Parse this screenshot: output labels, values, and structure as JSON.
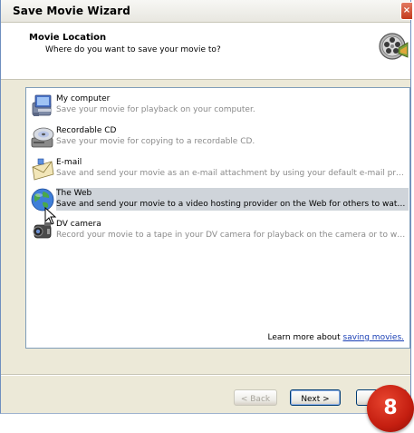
{
  "window": {
    "title": "Save Movie Wizard",
    "close_glyph": "×"
  },
  "header": {
    "title": "Movie Location",
    "subtitle": "Where do you want to save your movie to?",
    "icon": "film-reel-icon"
  },
  "items": [
    {
      "title": "My computer",
      "description": "Save your movie for playback on your computer.",
      "icon": "computer-icon",
      "selected": false
    },
    {
      "title": "Recordable CD",
      "description": "Save your movie for copying to a recordable CD.",
      "icon": "cd-drive-icon",
      "selected": false
    },
    {
      "title": "E-mail",
      "description": "Save and send your movie as an e-mail attachment by using your default e-mail program.",
      "icon": "envelope-icon",
      "selected": false
    },
    {
      "title": "The Web",
      "description": "Save and send your movie to a video hosting provider on the Web for others to watch.",
      "icon": "globe-icon",
      "selected": true
    },
    {
      "title": "DV camera",
      "description": "Record your movie to a tape in your DV camera for playback on the camera or to watch o...",
      "icon": "camcorder-icon",
      "selected": false
    }
  ],
  "learn_more": {
    "prefix": "Learn more about",
    "link": "saving movies."
  },
  "buttons": {
    "back": "< Back",
    "next": "Next >",
    "cancel": ""
  },
  "badge": {
    "number": "8",
    "color": "#c41e10"
  }
}
